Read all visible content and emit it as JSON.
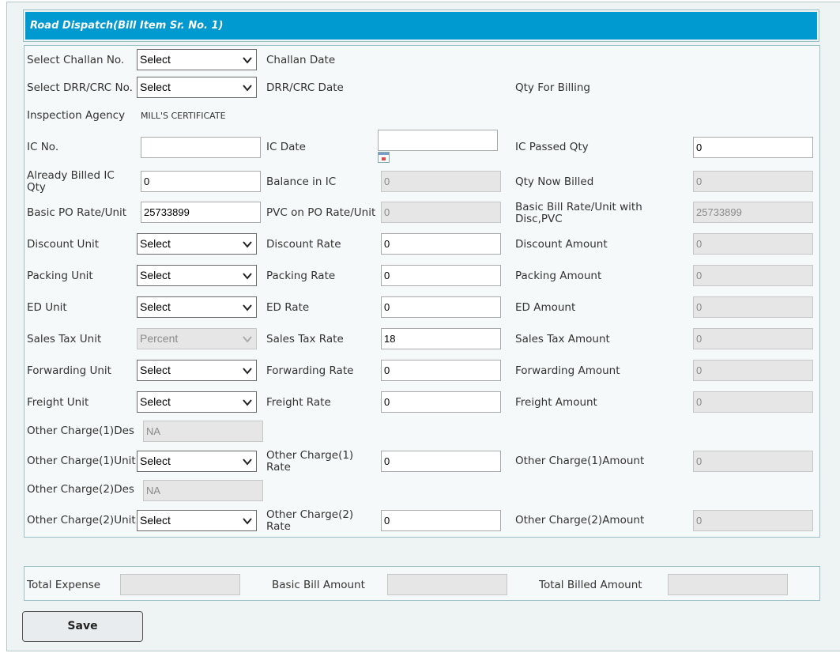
{
  "header": {
    "title": "Road Dispatch(Bill Item Sr. No. 1)"
  },
  "labels": {
    "challan_no": "Select Challan No.",
    "challan_date": "Challan Date",
    "drr_no": "Select DRR/CRC No.",
    "drr_date": "DRR/CRC Date",
    "qty_for_billing": "Qty For Billing",
    "inspection_agency": "Inspection Agency",
    "inspection_agency_value": "MILL'S CERTIFICATE",
    "ic_no": "IC No.",
    "ic_date": "IC Date",
    "ic_passed_qty": "IC Passed Qty",
    "already_billed": "Already Billed IC Qty",
    "balance_in_ic": "Balance in IC",
    "qty_now_billed": "Qty Now Billed",
    "basic_po_rate": "Basic PO Rate/Unit",
    "pvc_on_po": "PVC on PO Rate/Unit",
    "basic_bill_rate": "Basic Bill Rate/Unit with Disc,PVC",
    "discount_unit": "Discount Unit",
    "discount_rate": "Discount Rate",
    "discount_amount": "Discount Amount",
    "packing_unit": "Packing Unit",
    "packing_rate": "Packing Rate",
    "packing_amount": "Packing Amount",
    "ed_unit": "ED Unit",
    "ed_rate": "ED Rate",
    "ed_amount": "ED Amount",
    "sales_tax_unit": "Sales Tax Unit",
    "sales_tax_rate": "Sales Tax Rate",
    "sales_tax_amount": "Sales Tax Amount",
    "forwarding_unit": "Forwarding Unit",
    "forwarding_rate": "Forwarding Rate",
    "forwarding_amount": "Forwarding Amount",
    "freight_unit": "Freight Unit",
    "freight_rate": "Freight Rate",
    "freight_amount": "Freight Amount",
    "oc1_des": "Other Charge(1)Des",
    "oc1_unit": "Other Charge(1)Unit",
    "oc1_rate": "Other Charge(1) Rate",
    "oc1_amount": "Other Charge(1)Amount",
    "oc2_des": "Other Charge(2)Des",
    "oc2_unit": "Other Charge(2)Unit",
    "oc2_rate": "Other Charge(2) Rate",
    "oc2_amount": "Other Charge(2)Amount",
    "total_expense": "Total Expense",
    "basic_bill_amount": "Basic Bill Amount",
    "total_billed_amount": "Total Billed Amount"
  },
  "selects": {
    "challan_no": "Select",
    "drr_no": "Select",
    "discount_unit": "Select",
    "packing_unit": "Select",
    "ed_unit": "Select",
    "sales_tax_unit": "Percent",
    "forwarding_unit": "Select",
    "freight_unit": "Select",
    "oc1_unit": "Select",
    "oc2_unit": "Select"
  },
  "values": {
    "ic_no": "",
    "ic_date": "",
    "ic_passed_qty": "0",
    "already_billed": "0",
    "balance_in_ic": "0",
    "qty_now_billed": "0",
    "basic_po_rate": "25733899",
    "pvc_on_po": "0",
    "basic_bill_rate": "25733899",
    "discount_rate": "0",
    "discount_amount": "0",
    "packing_rate": "0",
    "packing_amount": "0",
    "ed_rate": "0",
    "ed_amount": "0",
    "sales_tax_rate": "18",
    "sales_tax_amount": "0",
    "forwarding_rate": "0",
    "forwarding_amount": "0",
    "freight_rate": "0",
    "freight_amount": "0",
    "oc1_des": "NA",
    "oc1_rate": "0",
    "oc1_amount": "0",
    "oc2_des": "NA",
    "oc2_rate": "0",
    "oc2_amount": "0",
    "total_expense": "",
    "basic_bill_amount": "",
    "total_billed_amount": ""
  },
  "buttons": {
    "save": "Save"
  },
  "icons": {
    "select_arrow": "chevron-down-icon",
    "date_picker": "calendar-icon"
  }
}
